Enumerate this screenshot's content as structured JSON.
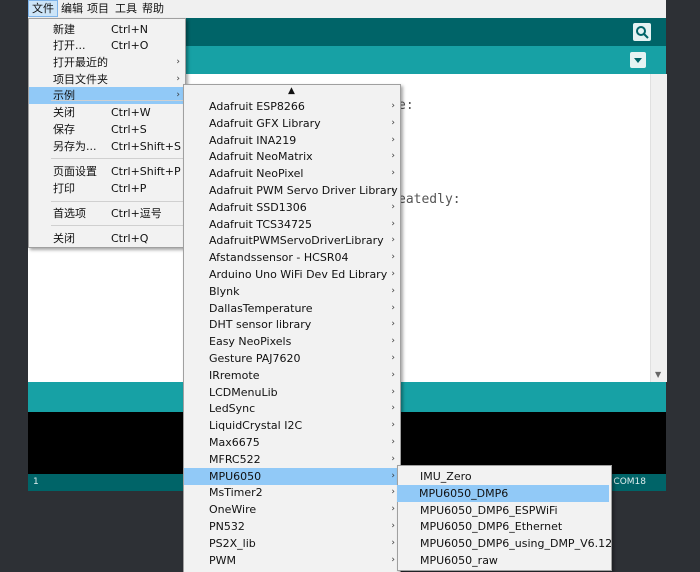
{
  "menubar": [
    "文件",
    "编辑",
    "项目",
    "工具",
    "帮助"
  ],
  "editor_fragments": [
    "e:",
    "eatedly:"
  ],
  "footer": {
    "line": "1",
    "port": "E COM18"
  },
  "file_menu": [
    {
      "label": "新建",
      "shortcut": "Ctrl+N"
    },
    {
      "label": "打开...",
      "shortcut": "Ctrl+O"
    },
    {
      "label": "打开最近的",
      "submenu": true
    },
    {
      "label": "项目文件夹",
      "submenu": true
    },
    {
      "label": "示例",
      "submenu": true,
      "highlighted": true
    },
    {
      "label": "关闭",
      "shortcut": "Ctrl+W"
    },
    {
      "label": "保存",
      "shortcut": "Ctrl+S"
    },
    {
      "label": "另存为...",
      "shortcut": "Ctrl+Shift+S"
    },
    {
      "label": "页面设置",
      "shortcut": "Ctrl+Shift+P"
    },
    {
      "label": "打印",
      "shortcut": "Ctrl+P"
    },
    {
      "label": "首选项",
      "shortcut": "Ctrl+逗号"
    },
    {
      "label": "关闭",
      "shortcut": "Ctrl+Q"
    }
  ],
  "examples_menu": {
    "scroll_up_glyph": "▲",
    "items": [
      "Adafruit ESP8266",
      "Adafruit GFX Library",
      "Adafruit INA219",
      "Adafruit NeoMatrix",
      "Adafruit NeoPixel",
      "Adafruit PWM Servo Driver Library",
      "Adafruit SSD1306",
      "Adafruit TCS34725",
      "AdafruitPWMServoDriverLibrary",
      "Afstandssensor - HCSR04",
      "Arduino Uno WiFi Dev Ed Library",
      "Blynk",
      "DallasTemperature",
      "DHT sensor library",
      "Easy NeoPixels",
      "Gesture PAJ7620",
      "IRremote",
      "LCDMenuLib",
      "LedSync",
      "LiquidCrystal I2C",
      "Max6675",
      "MFRC522",
      "MPU6050",
      "MsTimer2",
      "OneWire",
      "PN532",
      "PS2X_lib",
      "PWM"
    ],
    "selected": "MPU6050"
  },
  "mpu_menu": {
    "items": [
      "IMU_Zero",
      "MPU6050_DMP6",
      "MPU6050_DMP6_ESPWiFi",
      "MPU6050_DMP6_Ethernet",
      "MPU6050_DMP6_using_DMP_V6.12",
      "MPU6050_raw"
    ],
    "highlighted": "MPU6050_DMP6"
  },
  "icons": {
    "submenu_arrow": "›",
    "serial_monitor": "magnifier-icon",
    "tab_menu": "down-triangle-icon"
  }
}
